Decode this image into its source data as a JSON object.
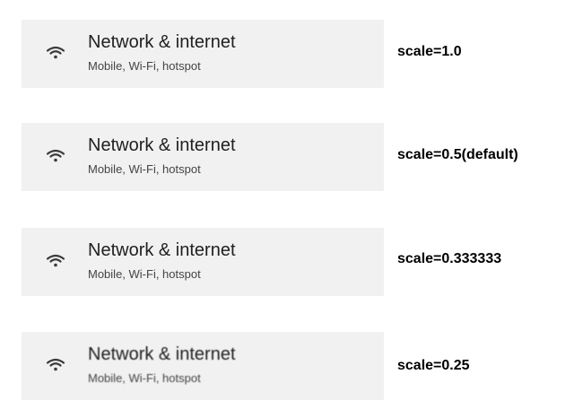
{
  "rows": [
    {
      "title": "Network & internet",
      "subtitle": "Mobile, Wi-Fi, hotspot",
      "icon": "wifi-icon",
      "scale_label": "scale=1.0"
    },
    {
      "title": "Network & internet",
      "subtitle": "Mobile, Wi-Fi, hotspot",
      "icon": "wifi-icon",
      "scale_label": "scale=0.5(default)"
    },
    {
      "title": "Network & internet",
      "subtitle": "Mobile, Wi-Fi, hotspot",
      "icon": "wifi-icon",
      "scale_label": "scale=0.333333"
    },
    {
      "title": "Network & internet",
      "subtitle": "Mobile, Wi-Fi, hotspot",
      "icon": "wifi-icon",
      "scale_label": "scale=0.25"
    }
  ]
}
